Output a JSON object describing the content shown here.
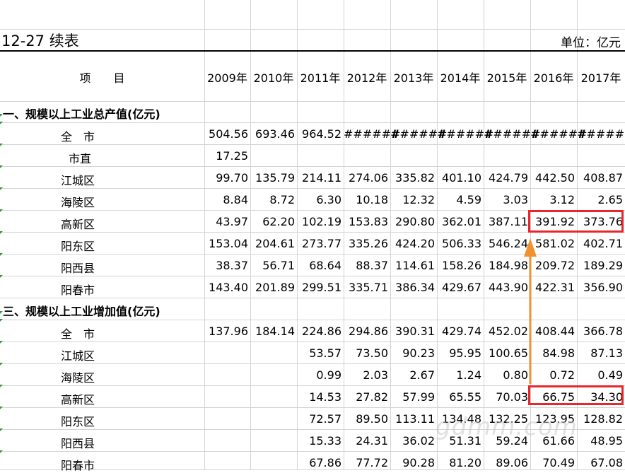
{
  "title": "12-27 续表",
  "unit": "单位：亿元",
  "header_item": "项　　目",
  "years": [
    "2009年",
    "2010年",
    "2011年",
    "2012年",
    "2013年",
    "2014年",
    "2015年",
    "2016年",
    "2017年"
  ],
  "section1": {
    "title": "一、规模以上工业总产值(亿元)",
    "rows": [
      {
        "name": "全　市",
        "values": [
          "504.56",
          "693.46",
          "964.52",
          "######",
          "######",
          "######",
          "######",
          "######",
          "######"
        ]
      },
      {
        "name": "市直",
        "values": [
          "17.25",
          "",
          "",
          "",
          "",
          "",
          "",
          "",
          ""
        ]
      },
      {
        "name": "江城区",
        "values": [
          "99.70",
          "135.79",
          "214.11",
          "274.06",
          "335.82",
          "401.10",
          "424.79",
          "442.50",
          "408.87"
        ]
      },
      {
        "name": "海陵区",
        "values": [
          "8.84",
          "8.72",
          "6.30",
          "10.18",
          "12.32",
          "4.59",
          "3.03",
          "3.12",
          "2.65"
        ]
      },
      {
        "name": "高新区",
        "values": [
          "43.97",
          "62.20",
          "102.19",
          "153.83",
          "290.80",
          "362.01",
          "387.11",
          "391.92",
          "373.76"
        ]
      },
      {
        "name": "阳东区",
        "values": [
          "153.04",
          "204.61",
          "273.77",
          "335.26",
          "424.20",
          "506.33",
          "546.24",
          "581.02",
          "402.71"
        ]
      },
      {
        "name": "阳西县",
        "values": [
          "38.37",
          "56.71",
          "68.64",
          "88.37",
          "114.61",
          "158.26",
          "184.98",
          "209.72",
          "189.29"
        ]
      },
      {
        "name": "阳春市",
        "values": [
          "143.40",
          "201.89",
          "299.51",
          "335.71",
          "386.34",
          "429.67",
          "443.90",
          "422.31",
          "356.90"
        ]
      }
    ]
  },
  "section3": {
    "title": "三、规模以上工业增加值(亿元)",
    "rows": [
      {
        "name": "全　市",
        "values": [
          "137.96",
          "184.14",
          "224.86",
          "294.86",
          "390.31",
          "429.74",
          "452.02",
          "408.44",
          "366.78"
        ]
      },
      {
        "name": "江城区",
        "values": [
          "",
          "",
          "53.57",
          "73.50",
          "90.23",
          "95.95",
          "100.65",
          "84.98",
          "87.13"
        ]
      },
      {
        "name": "海陵区",
        "values": [
          "",
          "",
          "0.99",
          "2.03",
          "2.67",
          "1.24",
          "0.80",
          "0.72",
          "0.49"
        ]
      },
      {
        "name": "高新区",
        "values": [
          "",
          "",
          "14.53",
          "27.82",
          "57.99",
          "65.55",
          "70.03",
          "66.75",
          "34.30"
        ]
      },
      {
        "name": "阳东区",
        "values": [
          "",
          "",
          "72.57",
          "89.50",
          "113.11",
          "134.48",
          "132.25",
          "123.95",
          "128.82"
        ]
      },
      {
        "name": "阳西县",
        "values": [
          "",
          "",
          "15.33",
          "24.31",
          "36.02",
          "51.31",
          "59.24",
          "61.66",
          "48.95"
        ]
      },
      {
        "name": "阳春市",
        "values": [
          "",
          "",
          "67.86",
          "77.72",
          "90.28",
          "81.20",
          "89.06",
          "70.49",
          "67.08"
        ]
      }
    ]
  },
  "watermark": "gdmm.com",
  "colors": {
    "highlight": "#e8262b",
    "arrow": "#f0922f",
    "grid": "#d4d4d4"
  }
}
